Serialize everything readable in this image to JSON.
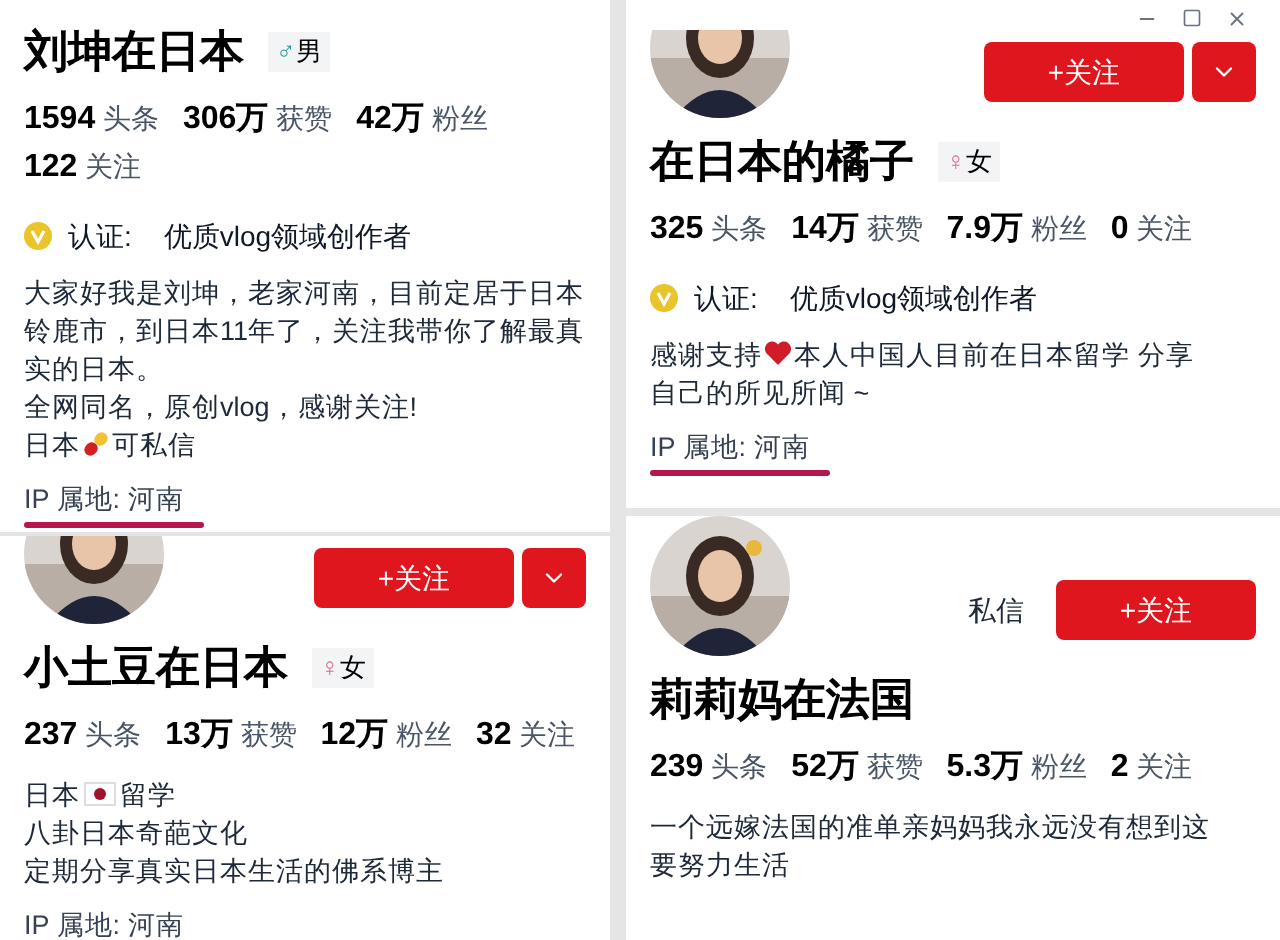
{
  "profiles": [
    {
      "name": "刘坤在日本",
      "gender": {
        "kind": "male",
        "symbol": "♂",
        "label": "男"
      },
      "window_controls": false,
      "stats": [
        {
          "count": "1594",
          "unit": "头条"
        },
        {
          "count": "306万",
          "unit": "获赞"
        },
        {
          "count": "42万",
          "unit": "粉丝"
        },
        {
          "count": "122",
          "unit": "关注"
        }
      ],
      "verification": {
        "label": "认证:",
        "value": "优质vlog领域创作者"
      },
      "bio": [
        {
          "segments": [
            {
              "kind": "text",
              "text": "大家好我是刘坤，老家河南，目前定居于日本铃鹿市，到日本11年了，关注我带你了解最真实的日本。"
            }
          ]
        },
        {
          "segments": [
            {
              "kind": "text",
              "text": "全网同名，原创vlog，感谢关注!"
            }
          ]
        },
        {
          "segments": [
            {
              "kind": "text",
              "text": "日本"
            },
            {
              "kind": "pill"
            },
            {
              "kind": "text",
              "text": "可私信"
            }
          ]
        }
      ],
      "ip": {
        "text": "IP 属地: 河南",
        "underlined": true
      }
    },
    {
      "name": "小土豆在日本",
      "avatar": {
        "kind": "picture"
      },
      "gender": {
        "kind": "female",
        "symbol": "♀",
        "label": "女"
      },
      "buttons": [
        {
          "kind": "follow",
          "text": "+关注"
        },
        {
          "kind": "more"
        }
      ],
      "window_controls": false,
      "stats": [
        {
          "count": "237",
          "unit": "头条"
        },
        {
          "count": "13万",
          "unit": "获赞"
        },
        {
          "count": "12万",
          "unit": "粉丝"
        },
        {
          "count": "32",
          "unit": "关注"
        }
      ],
      "bio": [
        {
          "segments": [
            {
              "kind": "text",
              "text": "日本"
            },
            {
              "kind": "flag"
            },
            {
              "kind": "text",
              "text": "留学"
            }
          ]
        },
        {
          "segments": [
            {
              "kind": "text",
              "text": "八卦日本奇葩文化"
            }
          ]
        },
        {
          "segments": [
            {
              "kind": "text",
              "text": "定期分享真实日本生活的佛系博主"
            }
          ]
        }
      ],
      "ip": {
        "text": "IP 属地: 河南"
      }
    },
    {
      "name": "在日本的橘子",
      "avatar": {
        "kind": "picture"
      },
      "gender": {
        "kind": "female",
        "symbol": "♀",
        "label": "女"
      },
      "buttons": [
        {
          "kind": "follow",
          "text": "+关注"
        },
        {
          "kind": "more"
        }
      ],
      "window_controls": true,
      "stats": [
        {
          "count": "325",
          "unit": "头条"
        },
        {
          "count": "14万",
          "unit": "获赞"
        },
        {
          "count": "7.9万",
          "unit": "粉丝"
        },
        {
          "count": "0",
          "unit": "关注"
        }
      ],
      "verification": {
        "label": "认证:",
        "value": "优质vlog领域创作者"
      },
      "bio": [
        {
          "segments": [
            {
              "kind": "text",
              "text": "感谢支持"
            },
            {
              "kind": "heart"
            },
            {
              "kind": "text",
              "text": "本人中国人目前在日本留学 分享"
            }
          ]
        },
        {
          "segments": [
            {
              "kind": "text",
              "text": "自己的所见所闻 ~"
            }
          ]
        }
      ],
      "ip": {
        "text": "IP 属地: 河南",
        "underlined": true
      }
    },
    {
      "name": "莉莉妈在法国",
      "avatar": {
        "kind": "picture"
      },
      "buttons": [
        {
          "kind": "message",
          "text": "私信"
        },
        {
          "kind": "follow",
          "text": "+关注"
        }
      ],
      "window_controls": false,
      "stats": [
        {
          "count": "239",
          "unit": "头条"
        },
        {
          "count": "52万",
          "unit": "获赞"
        },
        {
          "count": "5.3万",
          "unit": "粉丝"
        },
        {
          "count": "2",
          "unit": "关注"
        }
      ],
      "bio": [
        {
          "segments": [
            {
              "kind": "text",
              "text": "一个远嫁法国的准单亲妈妈我永远没有想到这"
            }
          ]
        },
        {
          "segments": [
            {
              "kind": "text",
              "text": "要努力生活"
            }
          ]
        }
      ]
    }
  ]
}
